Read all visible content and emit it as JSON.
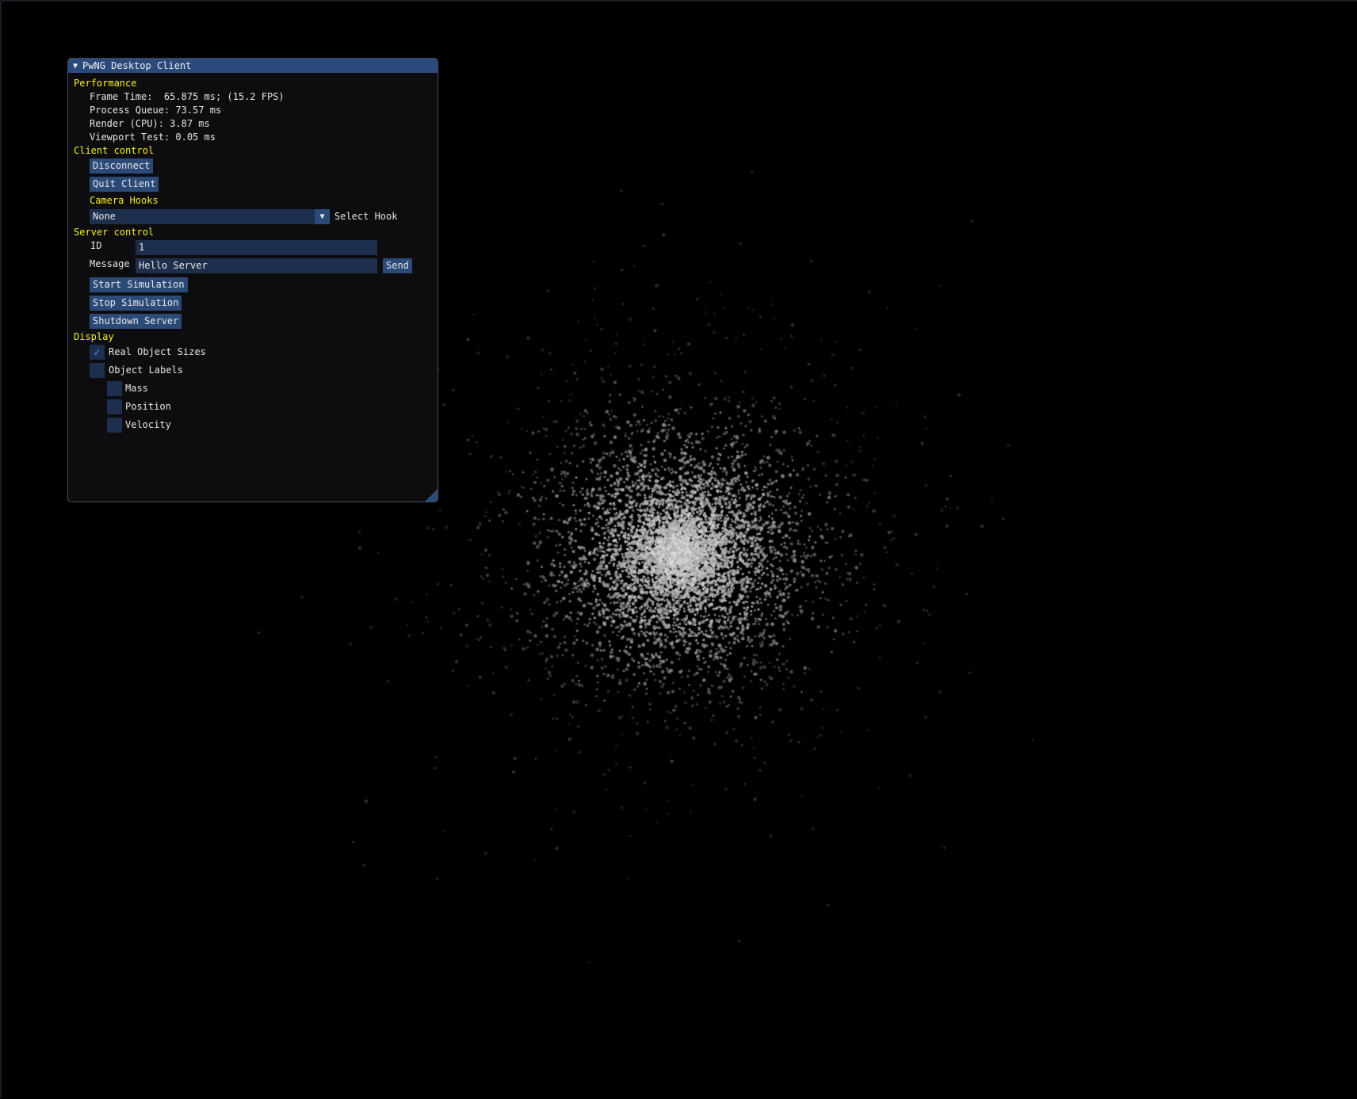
{
  "window": {
    "title": "PwNG Desktop Client",
    "collapse_icon": "triangle-down-icon"
  },
  "performance": {
    "header": "Performance",
    "frame_time": "Frame Time:  65.875 ms; (15.2 FPS)",
    "process_queue": "Process Queue: 73.57 ms",
    "render_cpu": "Render (CPU): 3.87 ms",
    "viewport_test": "Viewport Test: 0.05 ms"
  },
  "client_control": {
    "header": "Client control",
    "disconnect_label": "Disconnect",
    "quit_label": "Quit Client",
    "camera_hooks_header": "Camera Hooks",
    "hook_value": "None",
    "hook_label": "Select Hook"
  },
  "server_control": {
    "header": "Server control",
    "id_label": "ID",
    "id_value": "1",
    "message_label": "Message",
    "message_value": "Hello Server",
    "send_label": "Send",
    "start_label": "Start Simulation",
    "stop_label": "Stop Simulation",
    "shutdown_label": "Shutdown Server"
  },
  "display": {
    "header": "Display",
    "real_sizes_label": "Real Object Sizes",
    "real_sizes_checked": true,
    "object_labels_label": "Object Labels",
    "object_labels_checked": false,
    "mass_label": "Mass",
    "mass_checked": false,
    "position_label": "Position",
    "position_checked": false,
    "velocity_label": "Velocity",
    "velocity_checked": false
  },
  "colors": {
    "background": "#000000",
    "header_text": "#f7f21a",
    "button": "#2b4a78",
    "field": "#1d2f4c",
    "titlebar": "#294a7a",
    "checkmark": "#4a90ff"
  }
}
